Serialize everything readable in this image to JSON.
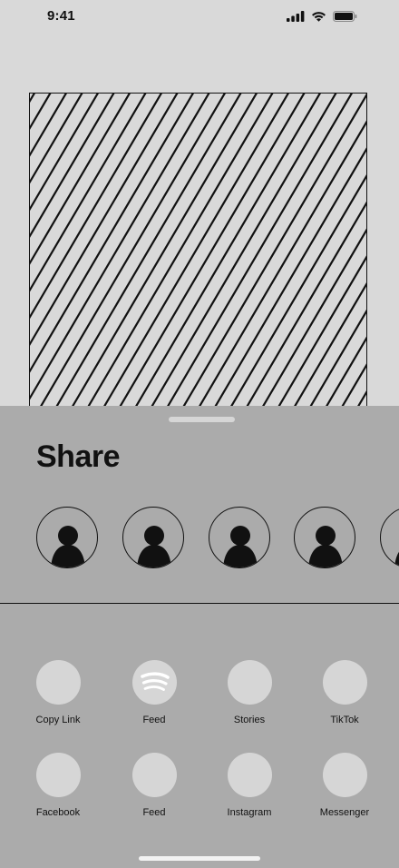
{
  "status_bar": {
    "time": "9:41",
    "icons": [
      "cellular-signal-icon",
      "wifi-icon",
      "battery-icon"
    ]
  },
  "preview": {
    "icon": "image-placeholder-hatched"
  },
  "share_sheet": {
    "title": "Share",
    "contacts": [
      {
        "icon": "person-avatar-icon"
      },
      {
        "icon": "person-avatar-icon"
      },
      {
        "icon": "person-avatar-icon"
      },
      {
        "icon": "person-avatar-icon"
      },
      {
        "icon": "person-avatar-icon"
      }
    ],
    "apps": [
      {
        "label": "Copy Link",
        "icon": "copy-link-icon"
      },
      {
        "label": "Feed",
        "icon": "spotify-icon"
      },
      {
        "label": "Stories",
        "icon": "stories-icon"
      },
      {
        "label": "TikTok",
        "icon": "tiktok-icon"
      },
      {
        "label": "Facebook",
        "icon": "facebook-icon"
      },
      {
        "label": "Feed",
        "icon": "feed-icon"
      },
      {
        "label": "Instagram",
        "icon": "instagram-icon"
      },
      {
        "label": "Messenger",
        "icon": "messenger-icon"
      }
    ]
  },
  "colors": {
    "background": "#d9d9d9",
    "sheet": "#ababab",
    "icon_fill": "#d6d6d6",
    "ink": "#111111"
  }
}
